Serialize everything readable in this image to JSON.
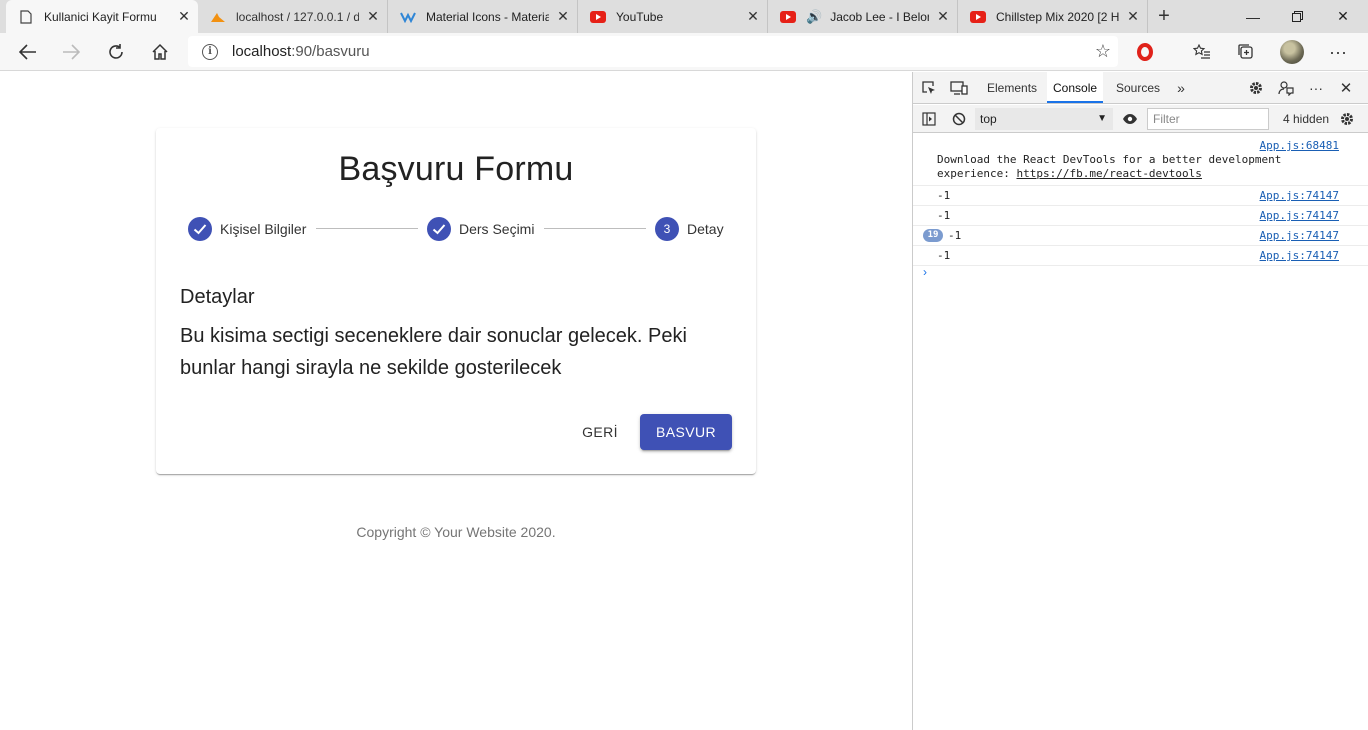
{
  "browser": {
    "tabs": [
      {
        "title": "Kullanici Kayit Formu",
        "icon": "page-icon",
        "active": true
      },
      {
        "title": "localhost / 127.0.0.1 / d",
        "icon": "phpmyadmin-icon",
        "active": false
      },
      {
        "title": "Material Icons - Materia",
        "icon": "material-icon",
        "active": false
      },
      {
        "title": "YouTube",
        "icon": "youtube-icon",
        "active": false
      },
      {
        "title": "Jacob Lee - I Belon",
        "icon": "youtube-icon",
        "active": false
      },
      {
        "title": "Chillstep Mix 2020 [2 H",
        "icon": "youtube-icon",
        "active": false
      }
    ],
    "url_host": "localhost",
    "url_path": ":90/basvuru"
  },
  "page": {
    "title": "Başvuru Formu",
    "steps": [
      {
        "label": "Kişisel Bilgiler",
        "state": "completed"
      },
      {
        "label": "Ders Seçimi",
        "state": "completed"
      },
      {
        "label": "Detay",
        "state": "active",
        "number": "3"
      }
    ],
    "section_title": "Detaylar",
    "section_body": "Bu kisima sectigi seceneklere dair sonuclar gelecek. Peki bunlar hangi sirayla ne sekilde gosterilecek",
    "back_label": "GERİ",
    "submit_label": "BASVUR",
    "copyright": "Copyright © Your Website 2020.",
    "accent": "#3f51b5"
  },
  "devtools": {
    "tabs": [
      "Elements",
      "Console",
      "Sources"
    ],
    "active_tab": "Console",
    "context": "top",
    "filter_placeholder": "Filter",
    "hidden_count": "4 hidden",
    "logs": [
      {
        "source": "App.js:68481",
        "msg_prefix": "Download the React DevTools for a better development",
        "msg_line2": "experience: ",
        "link": "https://fb.me/react-devtools"
      },
      {
        "source": "App.js:74147",
        "message": "-1"
      },
      {
        "source": "App.js:74147",
        "message": "-1"
      },
      {
        "source": "App.js:74147",
        "message": "-1",
        "repeat": "19"
      },
      {
        "source": "App.js:74147",
        "message": "-1"
      }
    ]
  }
}
